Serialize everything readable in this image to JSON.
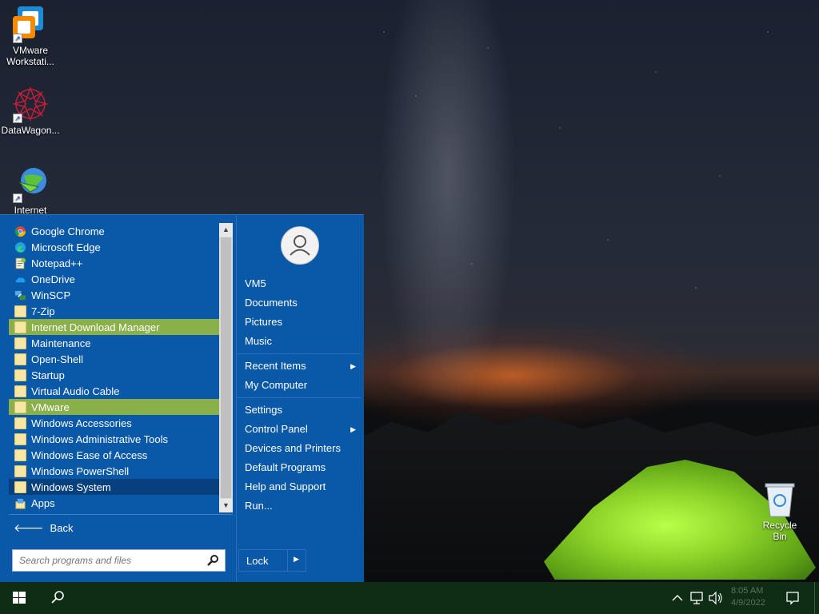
{
  "desktop": {
    "icons": [
      {
        "label": "VMware Workstati...",
        "icon": "vmware-icon"
      },
      {
        "label": "DataWagon...",
        "icon": "datawagon-icon"
      },
      {
        "label": "Internet",
        "icon": "internet-download-manager-icon"
      }
    ],
    "recycle_bin": {
      "label": "Recycle Bin",
      "icon": "recycle-bin-icon"
    }
  },
  "start_menu": {
    "programs": [
      {
        "label": "Google Chrome",
        "icon": "chrome-icon"
      },
      {
        "label": "Microsoft Edge",
        "icon": "edge-icon"
      },
      {
        "label": "Notepad++",
        "icon": "notepad-plus-plus-icon"
      },
      {
        "label": "OneDrive",
        "icon": "onedrive-icon"
      },
      {
        "label": "WinSCP",
        "icon": "winscp-icon"
      },
      {
        "label": "7-Zip",
        "icon": "folder-icon"
      },
      {
        "label": "Internet Download Manager",
        "icon": "folder-icon",
        "state": "highlighted"
      },
      {
        "label": "Maintenance",
        "icon": "folder-icon"
      },
      {
        "label": "Open-Shell",
        "icon": "folder-icon"
      },
      {
        "label": "Startup",
        "icon": "folder-icon"
      },
      {
        "label": "Virtual Audio Cable",
        "icon": "folder-icon"
      },
      {
        "label": "VMware",
        "icon": "folder-icon",
        "state": "highlighted"
      },
      {
        "label": "Windows Accessories",
        "icon": "folder-icon"
      },
      {
        "label": "Windows Administrative Tools",
        "icon": "folder-icon"
      },
      {
        "label": "Windows Ease of Access",
        "icon": "folder-icon"
      },
      {
        "label": "Windows PowerShell",
        "icon": "folder-icon"
      },
      {
        "label": "Windows System",
        "icon": "folder-icon",
        "state": "selected"
      },
      {
        "label": "Apps",
        "icon": "apps-icon"
      }
    ],
    "back_label": "Back",
    "search_placeholder": "Search programs and files",
    "right_pane": {
      "user_items": [
        "VM5",
        "Documents",
        "Pictures",
        "Music"
      ],
      "recent_items": "Recent Items",
      "my_computer": "My Computer",
      "settings": "Settings",
      "control_panel": "Control Panel",
      "devices_printers": "Devices and Printers",
      "default_programs": "Default Programs",
      "help_support": "Help and Support",
      "run": "Run...",
      "lock": "Lock"
    }
  },
  "taskbar": {
    "clock_time": "8:05 AM",
    "clock_date": "4/9/2022"
  },
  "colors": {
    "start_menu_bg": "#0a58a8",
    "highlight": "#8ab04a",
    "selected": "#07407c",
    "taskbar": "#0f2c15"
  }
}
